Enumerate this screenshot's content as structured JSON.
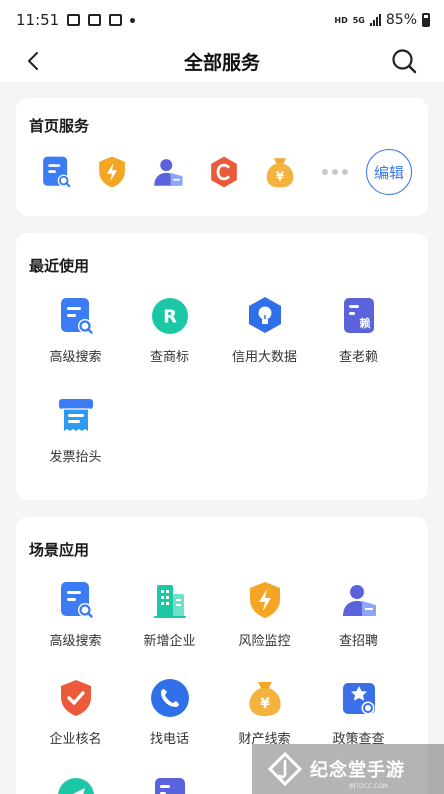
{
  "status_bar": {
    "time": "11:51",
    "hd": "HD",
    "network": "5G",
    "battery": "85%"
  },
  "nav": {
    "title": "全部服务"
  },
  "home_section": {
    "title": "首页服务",
    "icons": [
      "search-doc-icon",
      "shield-bolt-icon",
      "person-icon",
      "c-hexagon-icon",
      "money-bag-icon"
    ],
    "edit_label": "编辑"
  },
  "recent_section": {
    "title": "最近使用",
    "items": [
      {
        "label": "高级搜索",
        "icon": "search-doc-icon"
      },
      {
        "label": "查商标",
        "icon": "trademark-r-icon"
      },
      {
        "label": "信用大数据",
        "icon": "bulb-hexagon-icon"
      },
      {
        "label": "查老赖",
        "icon": "defaulter-doc-icon"
      },
      {
        "label": "发票抬头",
        "icon": "invoice-icon"
      }
    ]
  },
  "scene_section": {
    "title": "场景应用",
    "items": [
      {
        "label": "高级搜索",
        "icon": "search-doc-icon"
      },
      {
        "label": "新增企业",
        "icon": "building-icon"
      },
      {
        "label": "风险监控",
        "icon": "shield-bolt-icon"
      },
      {
        "label": "查招聘",
        "icon": "person-icon"
      },
      {
        "label": "企业核名",
        "icon": "shield-check-icon"
      },
      {
        "label": "找电话",
        "icon": "phone-icon"
      },
      {
        "label": "财产线索",
        "icon": "money-bag-icon"
      },
      {
        "label": "政策查查",
        "icon": "star-doc-icon"
      }
    ]
  },
  "watermark": {
    "text": "纪念堂手游",
    "sub": "JNTDCC.COM"
  },
  "colors": {
    "primary": "#3b78f0",
    "orange": "#f5a524",
    "red": "#ec5a3c",
    "teal": "#1cc7a5",
    "purple": "#5b63dc"
  }
}
